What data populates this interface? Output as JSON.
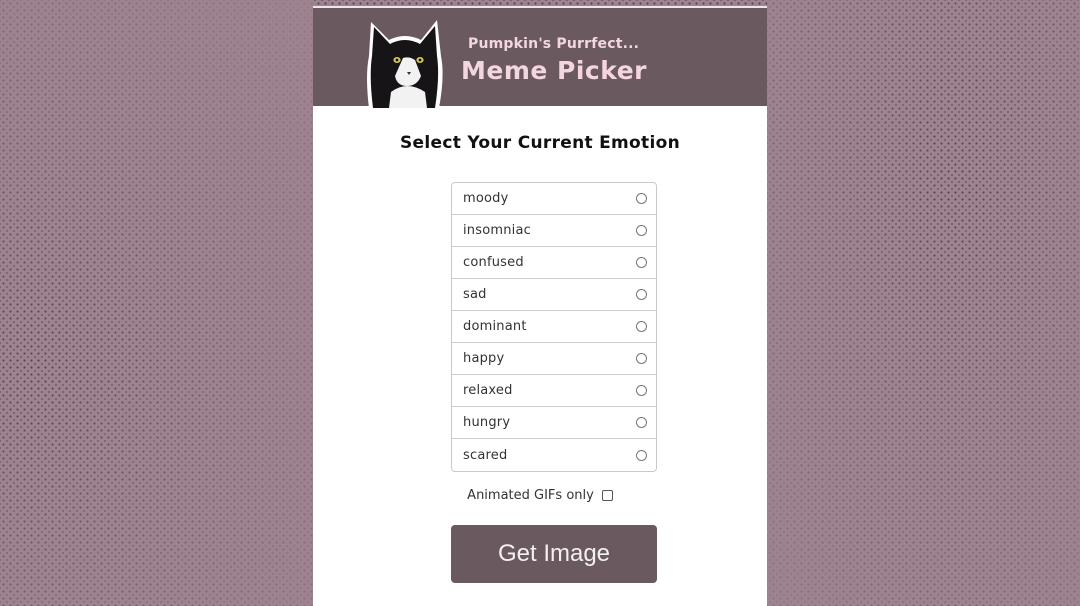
{
  "header": {
    "subtitle": "Pumpkin's Purrfect...",
    "title": "Meme Picker",
    "logo_icon": "cat-logo-icon"
  },
  "prompt": "Select Your Current Emotion",
  "emotions": [
    {
      "label": "moody"
    },
    {
      "label": "insomniac"
    },
    {
      "label": "confused"
    },
    {
      "label": "sad"
    },
    {
      "label": "dominant"
    },
    {
      "label": "happy"
    },
    {
      "label": "relaxed"
    },
    {
      "label": "hungry"
    },
    {
      "label": "scared"
    }
  ],
  "gif_toggle": {
    "label": "Animated GIFs only",
    "checked": false
  },
  "button": {
    "label": "Get Image"
  },
  "colors": {
    "accent": "#6b5960",
    "header_text": "#f4d6df",
    "page_background": "#9e8290"
  }
}
